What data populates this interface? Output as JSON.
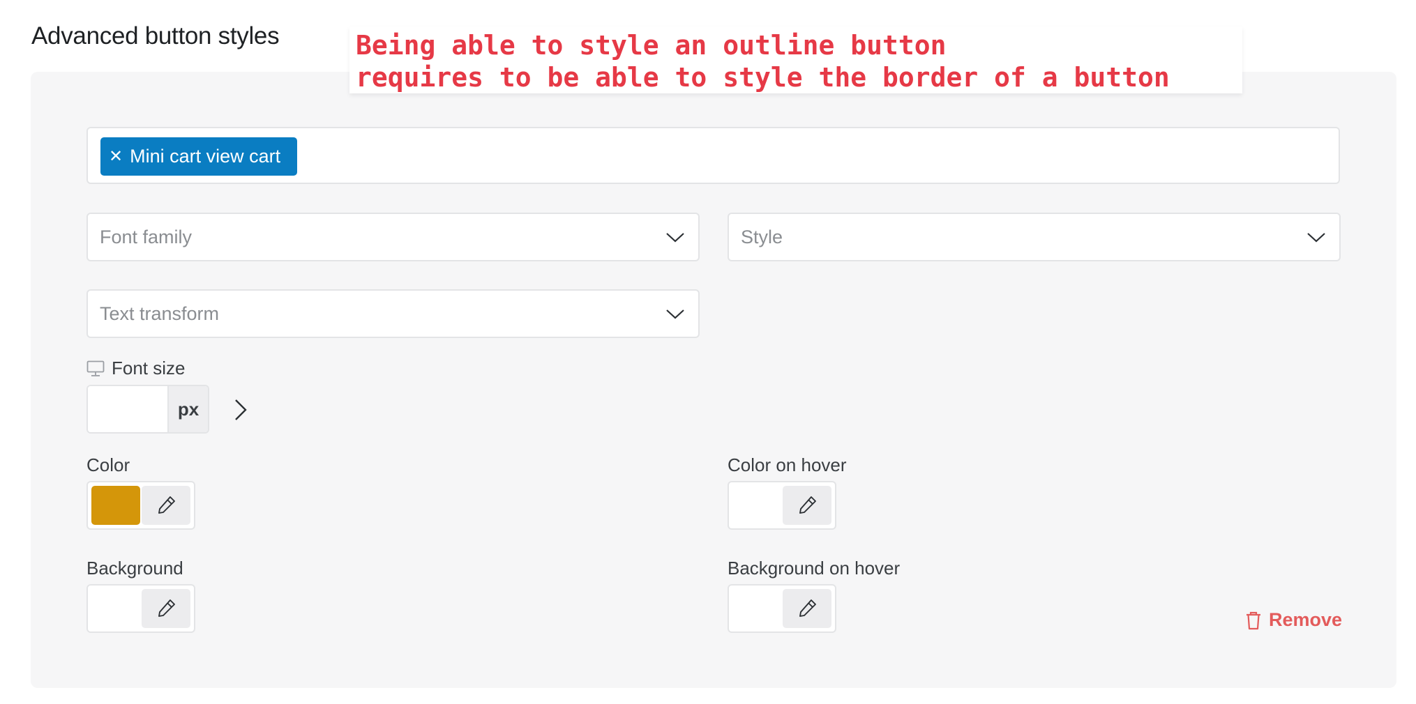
{
  "section": {
    "title": "Advanced button styles"
  },
  "note": {
    "line1": "Being able to style an outline button",
    "line2": "requires to be able to style the border of a button"
  },
  "selector": {
    "tag_label": "Mini cart view cart"
  },
  "fields": {
    "font_family_placeholder": "Font family",
    "style_placeholder": "Style",
    "text_transform_placeholder": "Text transform",
    "font_size_label": "Font size",
    "font_size_unit": "px",
    "font_size_value": ""
  },
  "colors": {
    "color_label": "Color",
    "color_value": "#d4960a",
    "color_hover_label": "Color on hover",
    "background_label": "Background",
    "background_hover_label": "Background on hover",
    "tag_color": "#0a7dc2",
    "remove_color": "#e35b5b"
  },
  "actions": {
    "remove_label": "Remove"
  }
}
